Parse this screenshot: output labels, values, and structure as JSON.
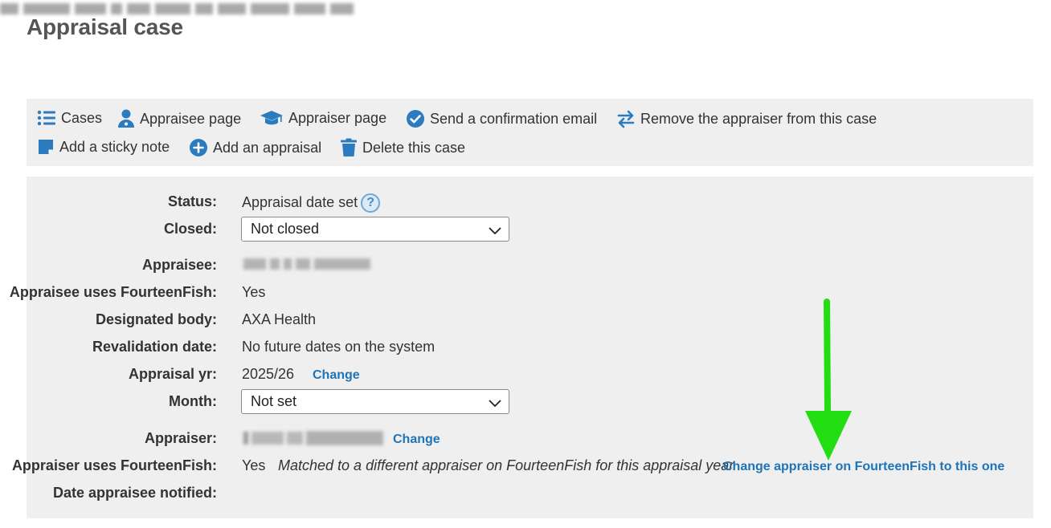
{
  "page": {
    "title": "Appraisal case"
  },
  "toolbar": {
    "items": [
      {
        "label": "Cases",
        "icon": "list-icon"
      },
      {
        "label": "Appraisee page",
        "icon": "user-doctor-icon"
      },
      {
        "label": "Appraiser page",
        "icon": "graduation-cap-icon"
      },
      {
        "label": "Send a confirmation email",
        "icon": "check-circle-icon"
      },
      {
        "label": "Remove the appraiser from this case",
        "icon": "swap-arrows-icon"
      },
      {
        "label": "Add a sticky note",
        "icon": "sticky-note-icon"
      },
      {
        "label": "Add an appraisal",
        "icon": "plus-circle-icon"
      },
      {
        "label": "Delete this case",
        "icon": "trash-icon"
      }
    ]
  },
  "details": {
    "status_label": "Status:",
    "status_value": "Appraisal date set",
    "help_glyph": "?",
    "closed_label": "Closed:",
    "closed_value": "Not closed",
    "appraisee_label": "Appraisee:",
    "appraisee_uses_label": "Appraisee uses FourteenFish:",
    "appraisee_uses_value": "Yes",
    "designated_body_label": "Designated body:",
    "designated_body_value": "AXA Health",
    "revalidation_label": "Revalidation date:",
    "revalidation_value": "No future dates on the system",
    "appraisal_yr_label": "Appraisal yr:",
    "appraisal_yr_value": "2025/26",
    "appraisal_yr_change": "Change",
    "month_label": "Month:",
    "month_value": "Not set",
    "appraiser_label": "Appraiser:",
    "appraiser_change": "Change",
    "appraiser_uses_label": "Appraiser uses FourteenFish:",
    "appraiser_uses_value": "Yes",
    "appraiser_match_note": "Matched to a different appraiser on FourteenFish for this appraisal year",
    "change_appraiser_link": "Change appraiser on FourteenFish to this one",
    "date_notified_label": "Date appraisee notified:"
  },
  "colors": {
    "link": "#1f73b7",
    "icon_blue": "#2a7bbf",
    "annotation_arrow": "#22dd11",
    "panel_bg": "#efefef"
  }
}
